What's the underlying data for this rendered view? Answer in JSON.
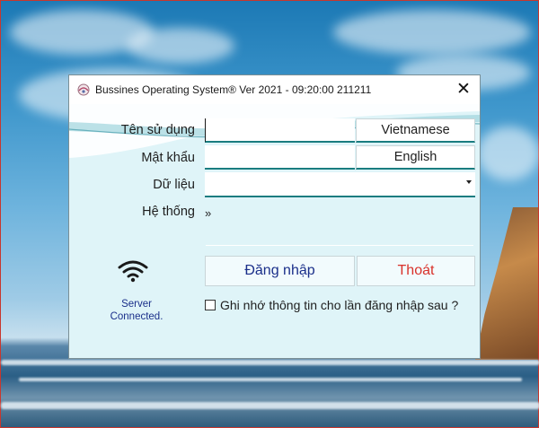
{
  "window": {
    "title": "Bussines Operating System® Ver 2021 - 09:20:00 211211",
    "close_glyph": "✕"
  },
  "form": {
    "username_label": "Tên sử dụng",
    "password_label": "Mật khẩu",
    "data_label": "Dữ liệu",
    "system_label": "Hệ thống",
    "system_link": "»",
    "username_value": "",
    "password_value": "",
    "data_value": ""
  },
  "language": {
    "vietnamese": "Vietnamese",
    "english": "English"
  },
  "status": {
    "line1": "Server",
    "line2": "Connected."
  },
  "actions": {
    "login": "Đăng nhập",
    "exit": "Thoát"
  },
  "remember": {
    "label": "Ghi nhớ thông tin cho lần đăng nhập sau ?",
    "checked": false
  },
  "colors": {
    "accent": "#1a7d80",
    "exit_text": "#d9322b",
    "login_text": "#1a2f8a",
    "status_text": "#1a2f8a"
  },
  "icons": [
    "app-icon",
    "wifi-icon",
    "close-icon",
    "dropdown-arrow-icon"
  ]
}
